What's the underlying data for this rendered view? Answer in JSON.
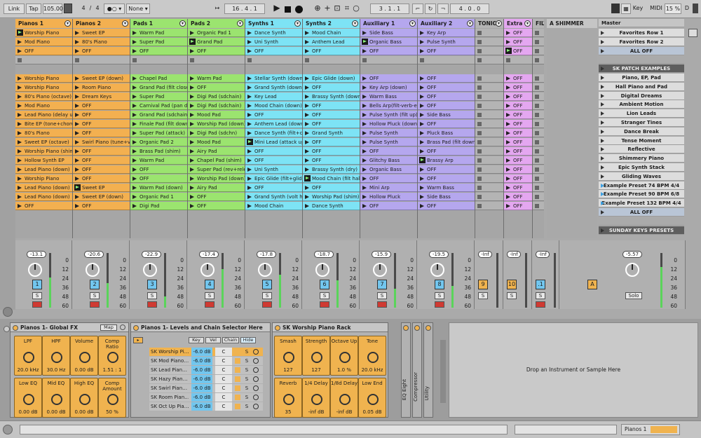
{
  "transport": {
    "link": "Link",
    "tap": "Tap",
    "tempo": "105.00",
    "sig_num": "4",
    "sig_den": "4",
    "none": "None",
    "position": "16 .  4 .  1",
    "loop_start": "3 .  1 .  1",
    "loop_len": "4 .  0 .  0",
    "key": "Key",
    "midi": "MIDI",
    "cpu": "15 %",
    "d": "D"
  },
  "tracks": [
    {
      "name": "Pianos 1",
      "color": "#f3b050",
      "cells": [
        "Worship Piano",
        "Mod Piano",
        "OFF",
        "",
        "Worship Piano",
        "Worship Piano",
        "80's Piano (octave)",
        "Mod Piano",
        "Lead Piano (delay up)",
        "Bite EP (tone+chorus)",
        "80's Piano",
        "Sweet EP (octave)",
        "Worship Piano (shim)",
        "Hollow Synth EP",
        "Lead Piano (down)",
        "Worship Piano",
        "Lead Piano (down)",
        "Lead Piano (down)",
        "OFF"
      ],
      "playing": [
        0
      ]
    },
    {
      "name": "Pianos 2",
      "color": "#f3b050",
      "cells": [
        "Sweet EP",
        "80's Piano",
        "OFF",
        "",
        "Sweet EP (down)",
        "Room Piano",
        "Dream Keys",
        "OFF",
        "OFF",
        "OFF",
        "OFF",
        "Swirl Piano (tune+verb)",
        "OFF",
        "OFF",
        "OFF",
        "OFF",
        "Sweet EP",
        "Sweet EP (down)",
        "OFF"
      ],
      "playing": [
        16
      ]
    },
    {
      "name": "Pads 1",
      "color": "#9be46f",
      "cells": [
        "Warm Pad",
        "Super Pad",
        "OFF",
        "",
        "Chapel Pad",
        "Grand Pad (filt close)",
        "Super Pad",
        "Carnival Pad (pan down)",
        "Grand Pad (sdchain)",
        "Finale Pad (filt down)",
        "Super Pad (attack)",
        "Organic Pad 2",
        "Brass Pad (shim)",
        "Warm Pad",
        "OFF",
        "OFF",
        "Warm Pad (down)",
        "Organic Pad 1",
        "Digi Pad"
      ],
      "playing": []
    },
    {
      "name": "Pads 2",
      "color": "#9be46f",
      "cells": [
        "Organic Pad 1",
        "Grand Pad",
        "OFF",
        "",
        "Warm Pad",
        "OFF",
        "Digi Pad (sdchain)",
        "Digi Pad (sdchain)",
        "Mood Pad",
        "Worship Pad (down)",
        "Digi Pad (sdchn)",
        "Mood Pad",
        "Airy Pad",
        "Chapel Pad (shim)",
        "Super Pad (rev+release)",
        "Worship Pad (down)",
        "Airy Pad",
        "OFF",
        "OFF"
      ],
      "playing": [
        1
      ]
    },
    {
      "name": "Synths 1",
      "color": "#7de3f5",
      "cells": [
        "Dance Synth",
        "Uni Synth",
        "OFF",
        "",
        "Stellar Synth (down)",
        "Grand Synth (down)",
        "Key Lead",
        "Mood Chain (down)",
        "OFF",
        "Anthem Lead (down)",
        "Dance Synth (filt+chorus)",
        "Mini Lead (attack up)",
        "OFF",
        "OFF",
        "Uni Synth",
        "Epic Glide (filt+glide)",
        "OFF",
        "Grand Synth (volt half)",
        "Mood Chain"
      ],
      "playing": [
        11
      ]
    },
    {
      "name": "Synths 2",
      "color": "#7de3f5",
      "cells": [
        "Mood Chain",
        "Anthem Lead",
        "OFF",
        "",
        "Epic Glide (down)",
        "OFF",
        "Brassy Synth (down)",
        "OFF",
        "OFF",
        "OFF",
        "Grand Synth",
        "OFF",
        "OFF",
        "OFF",
        "Brassy Synth (dry)",
        "Mood Chain (filt half)",
        "OFF",
        "Worship Pad (shim)",
        "Dance Synth"
      ],
      "playing": [
        15
      ]
    },
    {
      "name": "Auxiliary 1",
      "color": "#b5a7ee",
      "cells": [
        "Side Bass",
        "Organic Bass",
        "OFF",
        "",
        "OFF",
        "Key Arp (down)",
        "Warm Bass",
        "Bells Arp(filt-verb-ending)",
        "Pulse Synth (filt up)",
        "Hollow Pluck (down+verb)",
        "Pulse Synth",
        "Pulse Synth",
        "OFF",
        "Glitchy Bass",
        "Organic Bass",
        "OFF",
        "Mini Arp",
        "Hollow Pluck",
        "OFF"
      ],
      "playing": [
        1
      ]
    },
    {
      "name": "Auxiliary 2",
      "color": "#b5a7ee",
      "cells": [
        "Key Arp",
        "Pulse Synth",
        "OFF",
        "",
        "OFF",
        "OFF",
        "OFF",
        "OFF",
        "Side Bass",
        "OFF",
        "Pluck Bass",
        "Brass Pad (filt down)",
        "OFF",
        "Brassy Arp",
        "OFF",
        "OFF",
        "Warm Bass",
        "Side Bass",
        "OFF"
      ],
      "playing": [
        13
      ]
    },
    {
      "name": "TONIC",
      "color": "#b4b4b4",
      "cells": [
        "",
        "",
        "",
        "",
        "",
        "",
        "",
        "",
        "",
        "",
        "",
        "",
        "",
        "",
        "",
        "",
        "",
        "",
        ""
      ],
      "playing": []
    },
    {
      "name": "Extra",
      "color": "#e4a7f0",
      "cells": [
        "OFF",
        "OFF",
        "OFF",
        "",
        "OFF",
        "OFF",
        "OFF",
        "OFF",
        "OFF",
        "OFF",
        "OFF",
        "OFF",
        "OFF",
        "OFF",
        "OFF",
        "OFF",
        "OFF",
        "OFF",
        "OFF"
      ],
      "playing": [
        2
      ]
    },
    {
      "name": "FILTE",
      "color": "#b4b4b4",
      "cells": [
        "",
        "",
        "",
        "",
        "",
        "",
        "",
        "",
        "",
        "",
        "",
        "",
        "",
        "",
        "",
        "",
        "",
        "",
        ""
      ],
      "playing": []
    }
  ],
  "return_track": "A SHIMMER",
  "master": {
    "name": "Master",
    "scenes": [
      "Favorites Row 1",
      "Favorites Row 2",
      "ALL OFF",
      "",
      "SK PATCH EXAMPLES",
      "Piano, EP, Pad",
      "Hall Piano and Pad",
      "Digital Dreams",
      "Ambient Motion",
      "Lion Leads",
      "Stranger Tines",
      "Dance Break",
      "Tense Moment",
      "Reflective",
      "Shimmery Piano",
      "Epic Synth Stack",
      "Gliding Waves",
      "Example Preset 74 BPM 4/4",
      "Example Preset 90 BPM 6/8",
      "Example Preset 132 BPM 4/4",
      "ALL OFF",
      "",
      "SUNDAY KEYS PRESETS"
    ]
  },
  "mixer": {
    "volumes": [
      "-13.1",
      "-20.6",
      "-22.9",
      "-17.4",
      "-17.8",
      "-18.7",
      "-15.9",
      "-19.5",
      "-Inf",
      "-Inf",
      "-Inf",
      "-5.57"
    ],
    "numbers": [
      "1",
      "2",
      "3",
      "4",
      "5",
      "6",
      "7",
      "8",
      "9",
      "10",
      ".1",
      "A"
    ],
    "meter_levels": [
      0.55,
      0.45,
      0.2,
      0.7,
      0.6,
      0.5,
      0.35,
      0.4,
      0.0,
      0.0,
      0.0,
      0.75
    ],
    "scale": [
      "0",
      "12",
      "24",
      "36",
      "48",
      "60"
    ],
    "solo": "Solo",
    "s": "S",
    "c": "C"
  },
  "devices": {
    "global_fx": {
      "title": "Pianos 1- Global FX",
      "map": "Map",
      "knobs": [
        {
          "label": "LPF",
          "value": "20.0 kHz"
        },
        {
          "label": "HPF",
          "value": "30.0 Hz"
        },
        {
          "label": "Volume",
          "value": "0.00 dB"
        },
        {
          "label": "Comp Ratio",
          "value": "1.51 : 1"
        },
        {
          "label": "Low EQ",
          "value": "0.00 dB"
        },
        {
          "label": "Mid EQ",
          "value": "0.00 dB"
        },
        {
          "label": "High EQ",
          "value": "0.00 dB"
        },
        {
          "label": "Comp Amount",
          "value": "50 %"
        }
      ]
    },
    "chain": {
      "title": "Pianos 1- Levels and Chain Selector Here",
      "cols": [
        "Key",
        "Vel",
        "Chain",
        "Hide"
      ],
      "rows": [
        {
          "name": "SK Worship Pi…",
          "db": "-6.0 dB",
          "c": "C"
        },
        {
          "name": "SK Mod Piano…",
          "db": "-6.0 dB",
          "c": "C"
        },
        {
          "name": "SK Lead Pian…",
          "db": "-6.0 dB",
          "c": "C"
        },
        {
          "name": "SK Hazy Pian…",
          "db": "-6.0 dB",
          "c": "C"
        },
        {
          "name": "SK Swirl Pian…",
          "db": "-6.0 dB",
          "c": "C"
        },
        {
          "name": "SK Room Pian…",
          "db": "-6.0 dB",
          "c": "C"
        },
        {
          "name": "SK Oct Up Pia…",
          "db": "-6.0 dB",
          "c": "C"
        }
      ]
    },
    "rack": {
      "title": "SK Worship Piano Rack",
      "knobs": [
        {
          "label": "Smash",
          "value": "127"
        },
        {
          "label": "Strength",
          "value": "127"
        },
        {
          "label": "Octave Up",
          "value": "1.0 %"
        },
        {
          "label": "Tone",
          "value": "20.0 kHz"
        },
        {
          "label": "Reverb",
          "value": "35"
        },
        {
          "label": "1/4 Delay",
          "value": "-inf dB"
        },
        {
          "label": "1/8d Delay",
          "value": "-inf dB"
        },
        {
          "label": "Low End",
          "value": "0.05 dB"
        }
      ]
    },
    "folded": [
      "EQ Eight",
      "Compressor",
      "Utility"
    ],
    "drop": "Drop an Instrument or Sample Here"
  },
  "status": {
    "track": "Pianos 1"
  }
}
